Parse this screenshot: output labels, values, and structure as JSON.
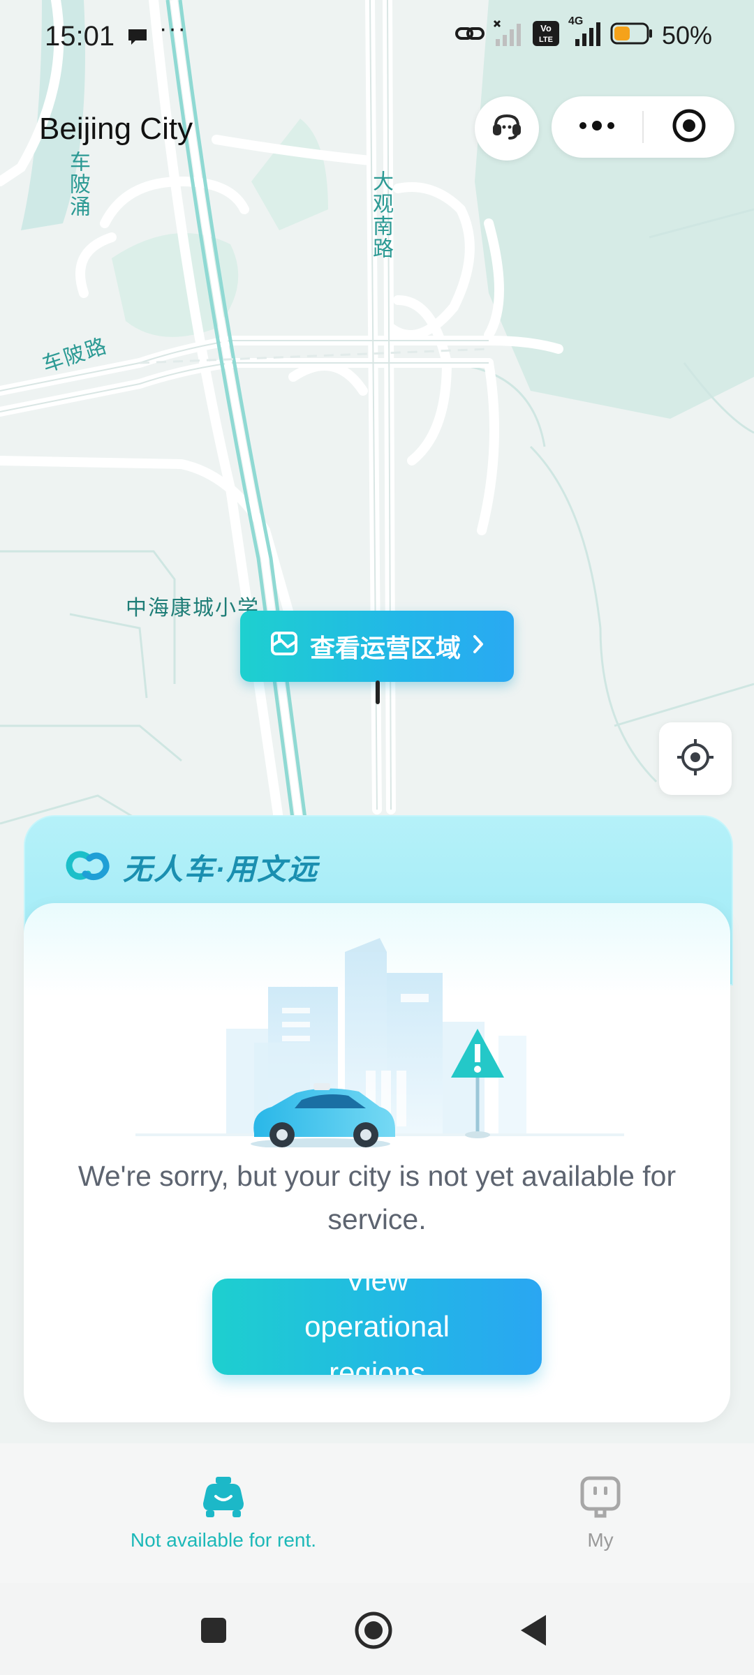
{
  "status_bar": {
    "time": "15:01",
    "more": "···",
    "network": "4G",
    "volte": "Vo LTE",
    "battery_percent": "50%",
    "battery_level": 0.5,
    "icons": [
      "chat-icon",
      "link-icon",
      "signal-x-icon",
      "volte-icon",
      "signal-icon",
      "battery-icon"
    ]
  },
  "header": {
    "city": "Beijing City",
    "support_icon": "headset-icon",
    "more_icon": "more-dots-icon",
    "close_icon": "target-circle-icon"
  },
  "map": {
    "labels": {
      "chelingyong": "车陂涌",
      "daguan_nanlu": "大观南路",
      "chelu": "车陂路",
      "school": "中海康城小学"
    },
    "area_chip": "查看运营区域",
    "locate_icon": "crosshair-icon"
  },
  "card": {
    "brand": "无人车·用文远",
    "brand_icon": "weride-logo-icon",
    "message": "We're sorry, but your city is not yet available for service.",
    "button": "View operational regions"
  },
  "tabbar": {
    "tabs": [
      {
        "label": "Not available for rent.",
        "icon": "car-icon",
        "active": true
      },
      {
        "label": "My",
        "icon": "profile-icon",
        "active": false
      }
    ]
  },
  "navbar": {
    "items": [
      "recents-square-icon",
      "home-circle-icon",
      "back-triangle-icon"
    ]
  },
  "colors": {
    "accent_teal": "#1ecfcf",
    "accent_blue": "#2aa6f2",
    "map_road": "#ffffff",
    "map_park": "#d9ede8",
    "map_water": "#9fdcd8"
  }
}
